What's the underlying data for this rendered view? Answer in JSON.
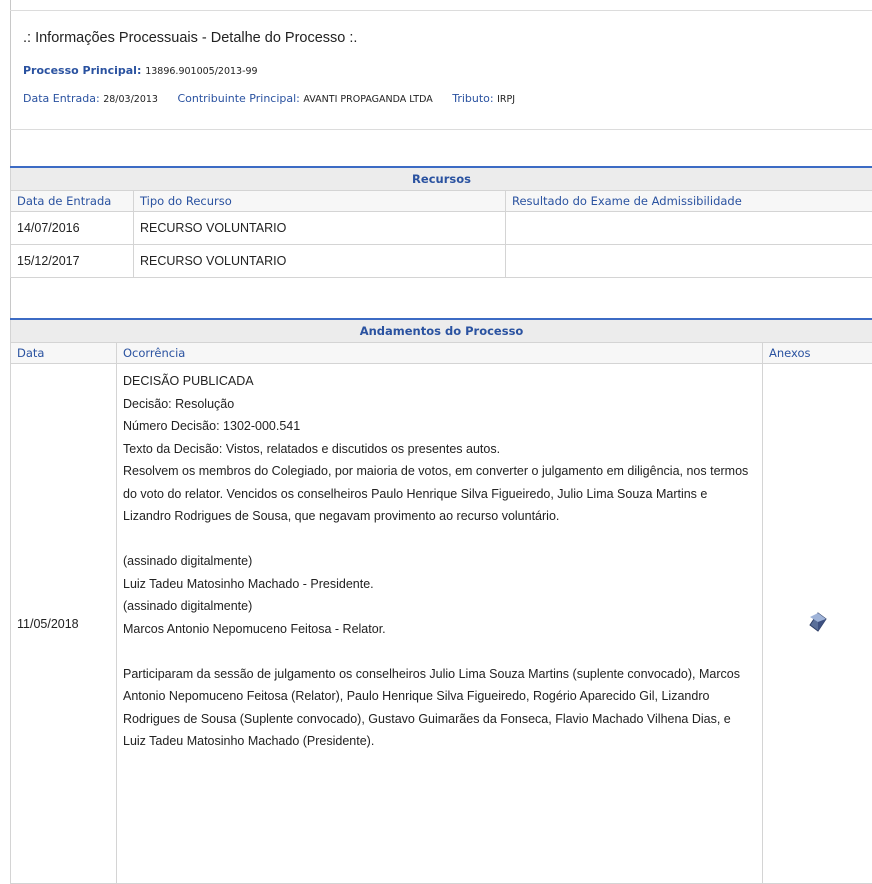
{
  "header": {
    "title": ".: Informações Processuais - Detalhe do Processo :.",
    "processo_label": "Processo Principal:",
    "processo_value": "13896.901005/2013-99",
    "data_entrada_label": "Data Entrada:",
    "data_entrada_value": "28/03/2013",
    "contribuinte_label": "Contribuinte Principal:",
    "contribuinte_value": "AVANTI PROPAGANDA LTDA",
    "tributo_label": "Tributo:",
    "tributo_value": "IRPJ"
  },
  "recursos": {
    "title": "Recursos",
    "columns": [
      "Data de Entrada",
      "Tipo do Recurso",
      "Resultado do Exame de Admissibilidade"
    ],
    "rows": [
      {
        "data": "14/07/2016",
        "tipo": "RECURSO VOLUNTARIO",
        "resultado": ""
      },
      {
        "data": "15/12/2017",
        "tipo": "RECURSO VOLUNTARIO",
        "resultado": ""
      }
    ]
  },
  "andamentos": {
    "title": "Andamentos do Processo",
    "columns": [
      "Data",
      "Ocorrência",
      "Anexos"
    ],
    "rows": [
      {
        "data": "11/05/2018",
        "ocorrencia": "DECISÃO PUBLICADA\nDecisão: Resolução\nNúmero Decisão: 1302-000.541\nTexto da Decisão: Vistos, relatados e discutidos os presentes autos.\nResolvem os membros do Colegiado, por maioria de votos, em converter o julgamento em diligência, nos termos do voto do relator. Vencidos os conselheiros Paulo Henrique Silva Figueiredo, Julio Lima Souza Martins e Lizandro Rodrigues de Sousa, que negavam provimento ao recurso voluntário.\n\n(assinado digitalmente)\nLuiz Tadeu Matosinho Machado - Presidente.\n(assinado digitalmente)\nMarcos Antonio Nepomuceno Feitosa - Relator.\n\nParticiparam da sessão de julgamento os conselheiros Julio Lima Souza Martins (suplente convocado), Marcos Antonio Nepomuceno Feitosa (Relator), Paulo Henrique Silva Figueiredo, Rogério Aparecido Gil, Lizandro Rodrigues de Sousa (Suplente convocado), Gustavo Guimarães da Fonseca, Flavio Machado Vilhena Dias, e Luiz Tadeu Matosinho Machado (Presidente).",
        "anexo_icon": "document-attachment-icon"
      }
    ]
  },
  "colors": {
    "accent": "#3c6bc4",
    "label": "#2a52a0",
    "header_bg": "#ececec"
  }
}
